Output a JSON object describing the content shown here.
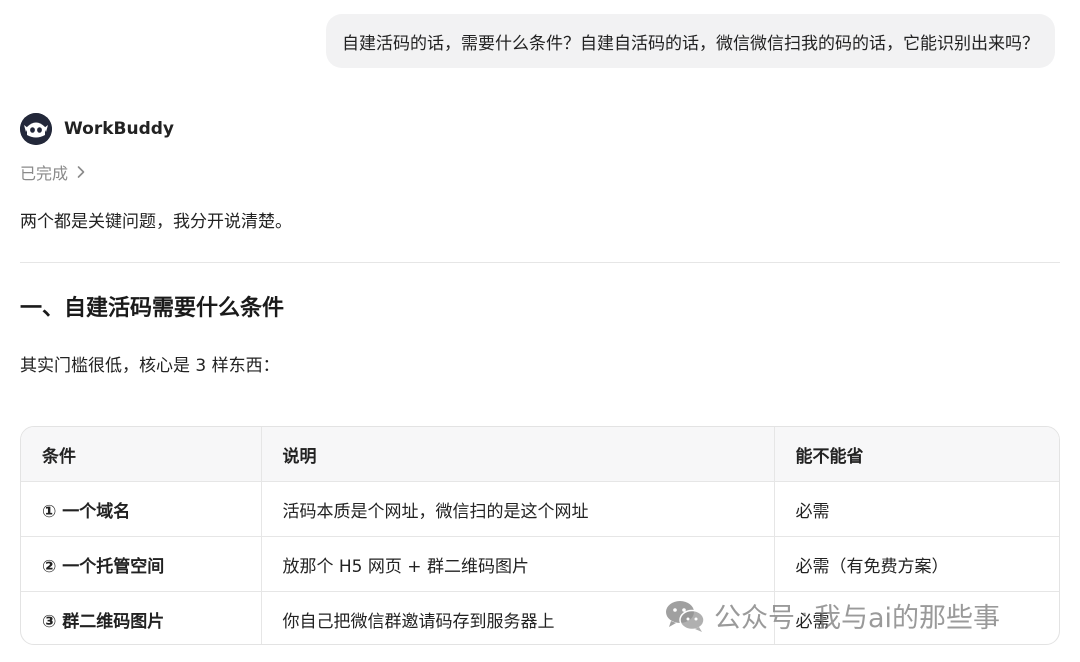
{
  "user_message": "自建活码的话，需要什么条件？自建自活码的话，微信微信扫我的码的话，它能识别出来吗？",
  "assistant": {
    "name": "WorkBuddy",
    "status": "已完成",
    "intro": "两个都是关键问题，我分开说清楚。",
    "section_title": "一、自建活码需要什么条件",
    "section_text": "其实门槛很低，核心是 3 样东西："
  },
  "table": {
    "headers": [
      "条件",
      "说明",
      "能不能省"
    ],
    "rows": [
      [
        "① 一个域名",
        "活码本质是个网址，微信扫的是这个网址",
        "必需"
      ],
      [
        "② 一个托管空间",
        "放那个 H5 网页 + 群二维码图片",
        "必需（有免费方案）"
      ],
      [
        "③ 群二维码图片",
        "你自己把微信群邀请码存到服务器上",
        "必需"
      ]
    ]
  },
  "watermark": {
    "prefix": "公众号",
    "separator": "·",
    "account": "我与ai的那些事"
  },
  "icons": {
    "avatar": "robot-avatar-icon",
    "chevron": "chevron-right-icon",
    "watermark": "wechat-icon"
  }
}
